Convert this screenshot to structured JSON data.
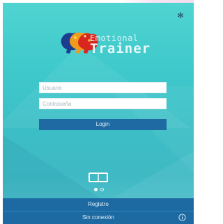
{
  "app": {
    "logo_top": "Emotional",
    "logo_bottom": "Trainer"
  },
  "login_form": {
    "username_placeholder": "Usuario",
    "password_placeholder": "Contraseña",
    "login_label": "Login"
  },
  "pager": {
    "active_page": 1,
    "page_count": 2
  },
  "footer": {
    "register_label": "Registro",
    "offline_label": "Sin conexión"
  },
  "icons": {
    "settings": "gear-icon",
    "logo": "brain-heads-logo-icon",
    "tutorial": "rectangle-icon",
    "info": "info-icon"
  },
  "colors": {
    "background_top": "#4fd4d1",
    "background_bottom": "#3fb9c4",
    "button_blue": "#1f6aa2",
    "footer_blue": "#1d6aa3"
  }
}
